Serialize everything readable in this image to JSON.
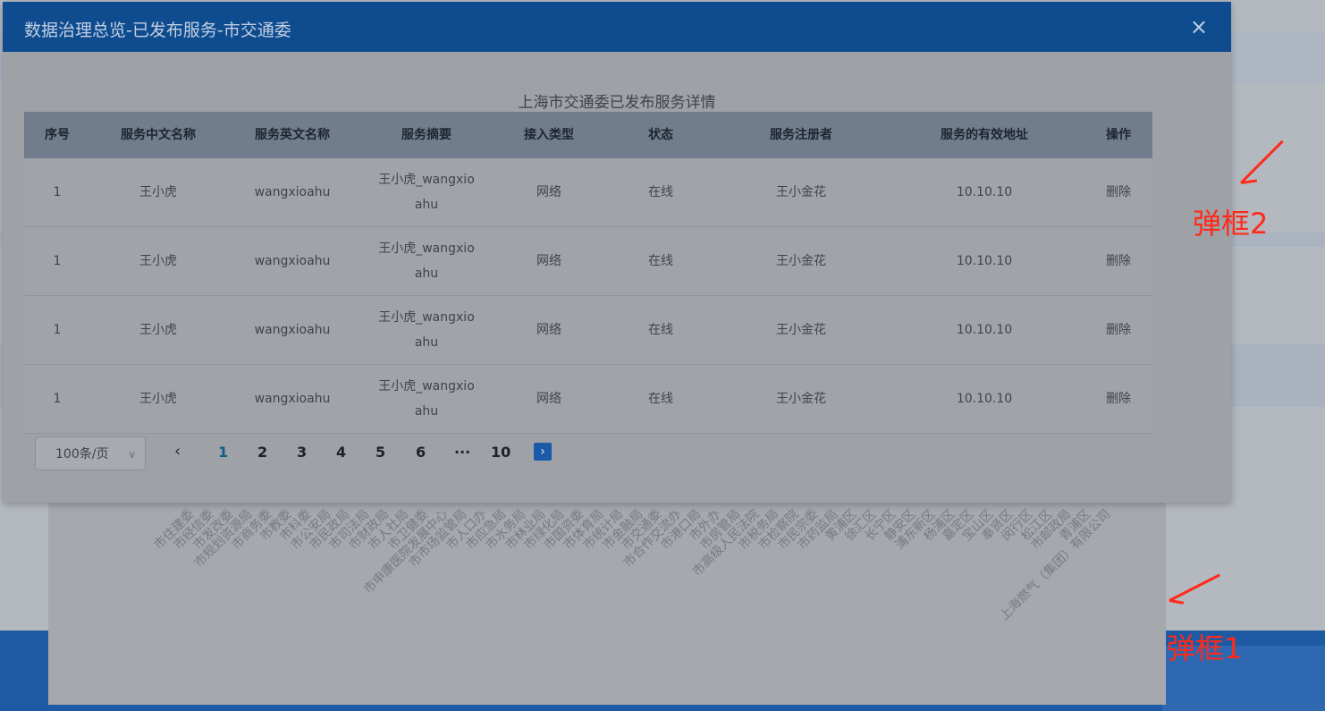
{
  "modal2": {
    "title": "数据治理总览-已发布服务-市交通委",
    "close_glyph": "×",
    "table_caption": "上海市交通委已发布服务详情",
    "columns": [
      "序号",
      "服务中文名称",
      "服务英文名称",
      "服务摘要",
      "接入类型",
      "状态",
      "服务注册者",
      "服务的有效地址",
      "操作"
    ],
    "rows": [
      {
        "index": "1",
        "cn_name": "王小虎",
        "en_name": "wangxioahu",
        "summary": "王小虎_wangxioahu",
        "access": "网络",
        "status": "在线",
        "registrant": "王小金花",
        "address": "10.10.10",
        "action": "删除"
      },
      {
        "index": "1",
        "cn_name": "王小虎",
        "en_name": "wangxioahu",
        "summary": "王小虎_wangxioahu",
        "access": "网络",
        "status": "在线",
        "registrant": "王小金花",
        "address": "10.10.10",
        "action": "删除"
      },
      {
        "index": "1",
        "cn_name": "王小虎",
        "en_name": "wangxioahu",
        "summary": "王小虎_wangxioahu",
        "access": "网络",
        "status": "在线",
        "registrant": "王小金花",
        "address": "10.10.10",
        "action": "删除"
      },
      {
        "index": "1",
        "cn_name": "王小虎",
        "en_name": "wangxioahu",
        "summary": "王小虎_wangxioahu",
        "access": "网络",
        "status": "在线",
        "registrant": "王小金花",
        "address": "10.10.10",
        "action": "删除"
      }
    ],
    "pager": {
      "page_size": "100条/页",
      "prev": "‹",
      "pages": [
        "1",
        "2",
        "3",
        "4",
        "5",
        "6",
        "···",
        "10"
      ],
      "current": "1",
      "next": "›"
    }
  },
  "modal1": {
    "axis_labels": [
      "市住建委",
      "市经信委",
      "市发改委",
      "市规划资源局",
      "市商务委",
      "市教委",
      "市科委",
      "市公安局",
      "市民政局",
      "市司法局",
      "市财政局",
      "市人社局",
      "市卫健委",
      "市申康医院发展中心",
      "市市场监管局",
      "市人口办",
      "市应急局",
      "市水务局",
      "市林业局",
      "市绿化局",
      "市国资委",
      "市体育局",
      "市统计局",
      "市金融局",
      "市交通委",
      "市合作交流办",
      "市港口局",
      "市外办",
      "市房管局",
      "市高级人民法院",
      "市税务局",
      "市检察院",
      "市民宗委",
      "市药监局",
      "黄浦区",
      "徐汇区",
      "长宁区",
      "静安区",
      "浦东新区",
      "杨浦区",
      "嘉定区",
      "宝山区",
      "奉贤区",
      "闵行区",
      "松江区",
      "市邮政局",
      "青浦区",
      "上海燃气（集团）有限公司"
    ]
  },
  "annotations": {
    "label2": "弹框2",
    "label1": "弹框1",
    "color": "#ff2a1a"
  }
}
